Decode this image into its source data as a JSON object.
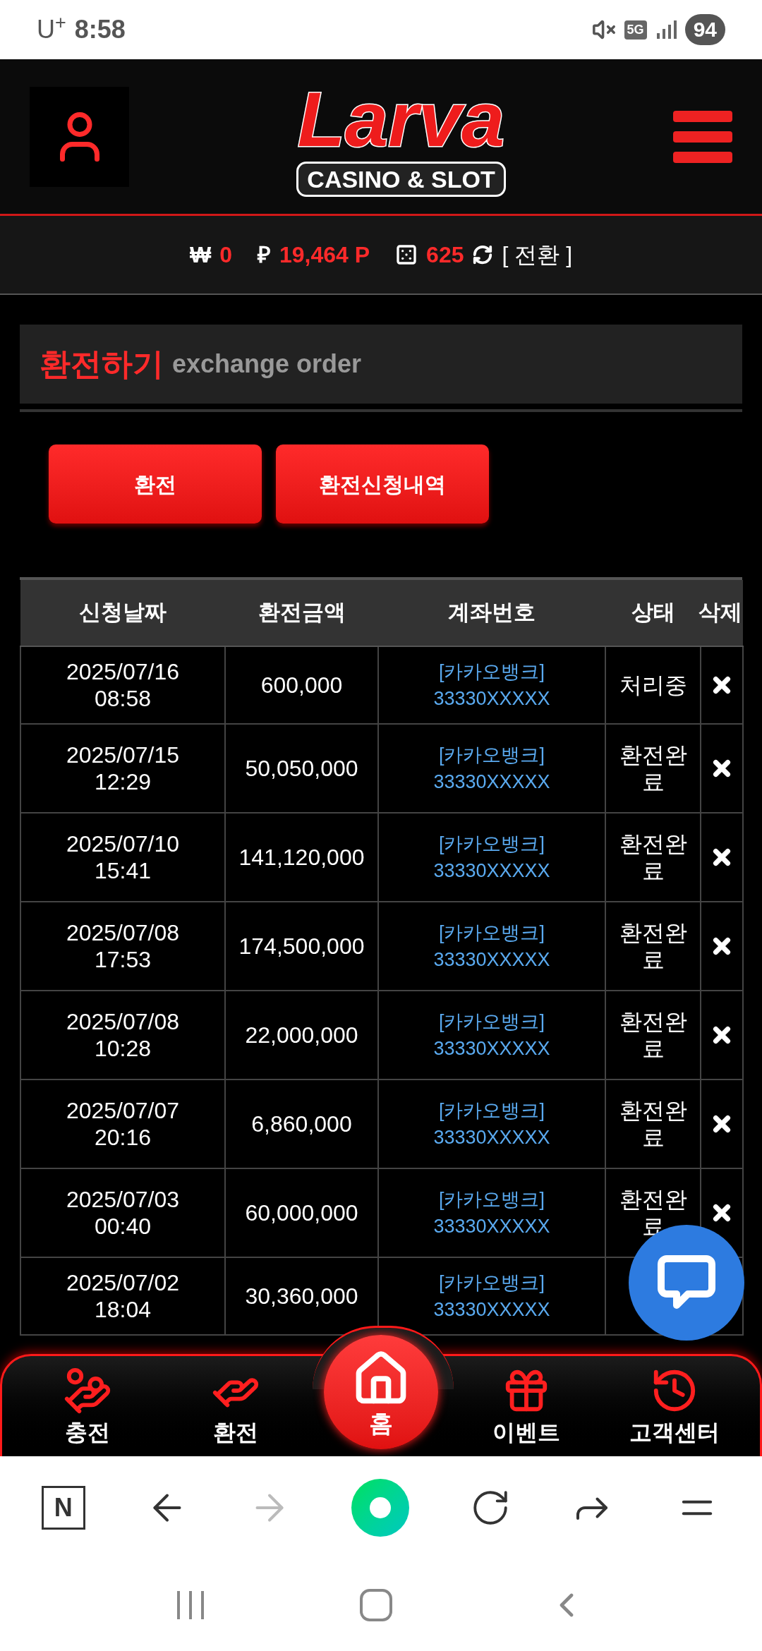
{
  "status_bar": {
    "carrier": "U$^{+}$",
    "time": "8:58",
    "network": "5G",
    "battery": "94"
  },
  "header": {
    "logo_title": "Larva",
    "logo_subtitle": "CASINO & SLOT"
  },
  "balance": {
    "won_symbol": "₩",
    "won": "0",
    "point_symbol": "₽",
    "points": "19,464 P",
    "chips": "625",
    "convert": "[ 전환 ]"
  },
  "page_title": {
    "korean": "환전하기",
    "english": "exchange order"
  },
  "buttons": [
    "환전",
    "환전신청내역"
  ],
  "table": {
    "columns": [
      "신청날짜",
      "환전금액",
      "계좌번호",
      "상태",
      "삭제"
    ],
    "rows": [
      {
        "date": "2025/07/16",
        "time": "08:58",
        "amount": "600,000",
        "bank": "[카카오뱅크]",
        "account": "33330XXXXX",
        "status": "처리중",
        "delete_visible": true
      },
      {
        "date": "2025/07/15",
        "time": "12:29",
        "amount": "50,050,000",
        "bank": "[카카오뱅크]",
        "account": "33330XXXXX",
        "status": "환전완료",
        "delete_visible": true
      },
      {
        "date": "2025/07/10",
        "time": "15:41",
        "amount": "141,120,000",
        "bank": "[카카오뱅크]",
        "account": "33330XXXXX",
        "status": "환전완료",
        "delete_visible": true
      },
      {
        "date": "2025/07/08",
        "time": "17:53",
        "amount": "174,500,000",
        "bank": "[카카오뱅크]",
        "account": "33330XXXXX",
        "status": "환전완료",
        "delete_visible": true
      },
      {
        "date": "2025/07/08",
        "time": "10:28",
        "amount": "22,000,000",
        "bank": "[카카오뱅크]",
        "account": "33330XXXXX",
        "status": "환전완료",
        "delete_visible": true
      },
      {
        "date": "2025/07/07",
        "time": "20:16",
        "amount": "6,860,000",
        "bank": "[카카오뱅크]",
        "account": "33330XXXXX",
        "status": "환전완료",
        "delete_visible": true
      },
      {
        "date": "2025/07/03",
        "time": "00:40",
        "amount": "60,000,000",
        "bank": "[카카오뱅크]",
        "account": "33330XXXXX",
        "status": "환전완료",
        "delete_visible": true
      },
      {
        "date": "2025/07/02",
        "time": "18:04",
        "amount": "30,360,000",
        "bank": "[카카오뱅크]",
        "account": "33330XXXXX",
        "delete_visible": false
      }
    ]
  },
  "bottom_nav": [
    {
      "kind": "deposit",
      "label": "충전",
      "selected": false
    },
    {
      "kind": "withdraw",
      "label": "환전",
      "selected": false
    },
    {
      "kind": "home",
      "label": "홈",
      "selected": true
    },
    {
      "kind": "event",
      "label": "이벤트",
      "selected": false
    },
    {
      "kind": "support",
      "label": "고객센터",
      "selected": false
    }
  ],
  "browser_toolbar": {
    "logo_letter": "N",
    "forward_disabled": true
  }
}
